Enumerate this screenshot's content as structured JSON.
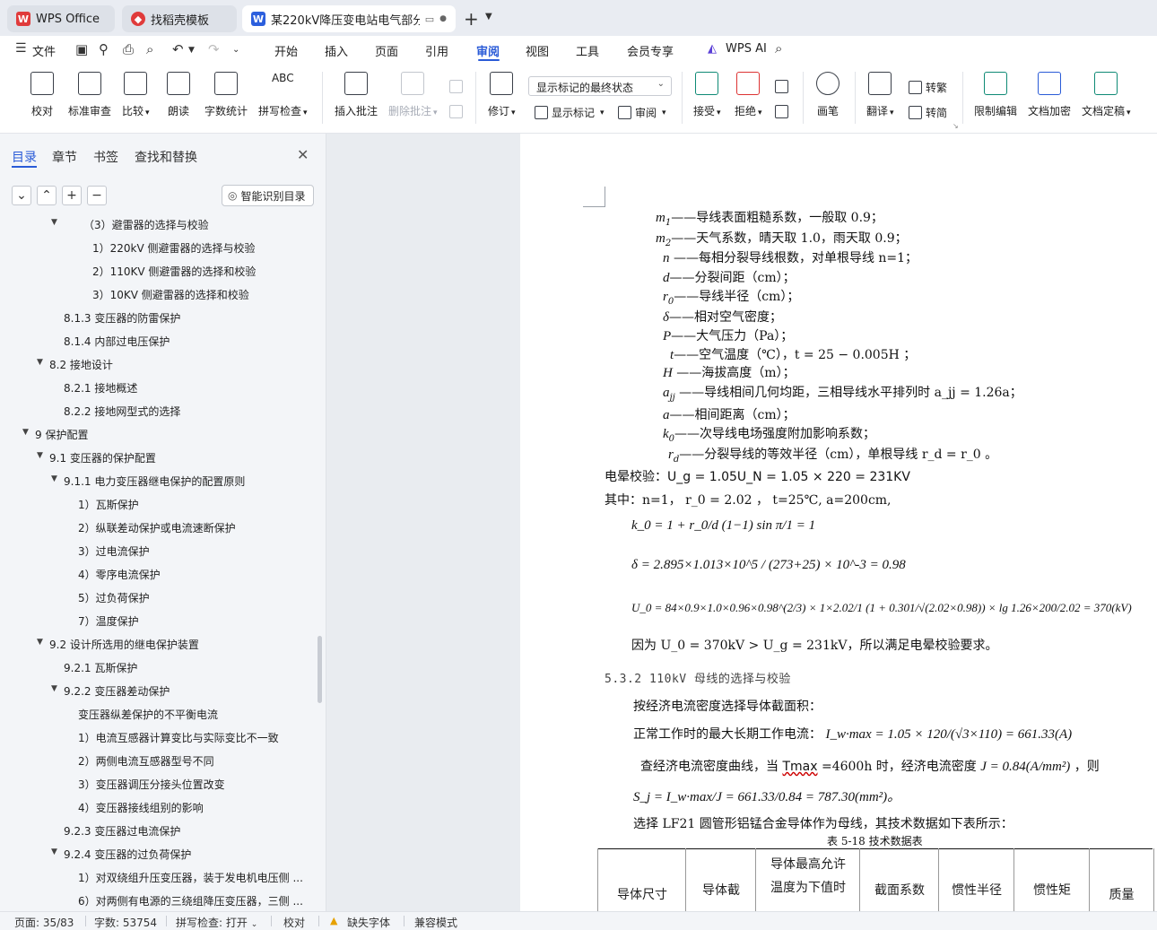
{
  "tabs": [
    {
      "label": "WPS Office",
      "icon": "wps-logo-icon"
    },
    {
      "label": "找稻壳模板",
      "icon": "docer-icon"
    },
    {
      "label": "某220kV降压变电站电气部分",
      "icon": "word-doc-icon",
      "active": true
    }
  ],
  "menu": {
    "file": "文件",
    "items": [
      "开始",
      "插入",
      "页面",
      "引用",
      "审阅",
      "视图",
      "工具",
      "会员专享"
    ],
    "active": "审阅",
    "ai": "WPS AI"
  },
  "ribbon": {
    "proofread": "校对",
    "standard_review": "标准审查",
    "compare": "比较",
    "read_aloud": "朗读",
    "word_count": "字数统计",
    "spellcheck": "拼写检查",
    "spellcheck_icon_text": "ABC",
    "insert_comment": "插入批注",
    "delete_comment": "删除批注",
    "track_changes": "修订",
    "markup_display_value": "显示标记的最终状态",
    "show_markup": "显示标记",
    "review_pane": "审阅",
    "accept": "接受",
    "reject": "拒绝",
    "pen": "画笔",
    "translate": "翻译",
    "to_traditional": "转繁",
    "to_simplified": "转简",
    "restrict_edit": "限制编辑",
    "encrypt": "文档加密",
    "finalize": "文档定稿"
  },
  "nav": {
    "tabs": [
      "目录",
      "章节",
      "书签",
      "查找和替换"
    ],
    "smart_toc": "智能识别目录",
    "toc": [
      {
        "label": "（3）避雷器的选择与校验",
        "level": 2,
        "arrow": "down"
      },
      {
        "label": "1）220kV 侧避雷器的选择与校验",
        "level": 3
      },
      {
        "label": "2）110KV 侧避雷器的选择和校验",
        "level": 3
      },
      {
        "label": "3）10KV 侧避雷器的选择和校验",
        "level": 3
      },
      {
        "label": "8.1.3  变压器的防雷保护",
        "level": 2
      },
      {
        "label": "8.1.4 内部过电压保护",
        "level": 2
      },
      {
        "label": "8.2  接地设计",
        "level": 1,
        "arrow": "down"
      },
      {
        "label": "8.2.1  接地概述",
        "level": 2
      },
      {
        "label": "8.2.2  接地网型式的选择",
        "level": 2
      },
      {
        "label": "9  保护配置",
        "level": 0,
        "arrow": "down"
      },
      {
        "label": "9.1  变压器的保护配置",
        "level": 1,
        "arrow": "down"
      },
      {
        "label": "9.1.1 电力变压器继电保护的配置原则",
        "level": 2,
        "arrow": "down"
      },
      {
        "label": "1）瓦斯保护",
        "level": 3
      },
      {
        "label": "2）纵联差动保护或电流速断保护",
        "level": 3
      },
      {
        "label": "3）过电流保护",
        "level": 3
      },
      {
        "label": "4）零序电流保护",
        "level": 3
      },
      {
        "label": "5）过负荷保护",
        "level": 3
      },
      {
        "label": "7）温度保护",
        "level": 3
      },
      {
        "label": "9.2 设计所选用的继电保护装置",
        "level": 1,
        "arrow": "down"
      },
      {
        "label": "9.2.1 瓦斯保护",
        "level": 2
      },
      {
        "label": "9.2.2 变压器差动保护",
        "level": 2,
        "arrow": "down"
      },
      {
        "label": "变压器纵差保护的不平衡电流",
        "level": 3
      },
      {
        "label": "1）电流互感器计算变比与实际变比不一致",
        "level": 3
      },
      {
        "label": "2）两侧电流互感器型号不同",
        "level": 3
      },
      {
        "label": "3）变压器调压分接头位置改变",
        "level": 3
      },
      {
        "label": "4）变压器接线组别的影响",
        "level": 3
      },
      {
        "label": "9.2.3  变压器过电流保护",
        "level": 2
      },
      {
        "label": "9.2.4 变压器的过负荷保护",
        "level": 2,
        "arrow": "down"
      },
      {
        "label": "1）对双绕组升压变压器，装于发电机电压侧 ...",
        "level": 3
      },
      {
        "label": "6）对两侧有电源的三绕组降压变压器，三侧 ...",
        "level": 3
      }
    ]
  },
  "doc": {
    "defs": [
      {
        "sym": "m",
        "sub": "1",
        "text": "——导线表面粗糙系数，一般取 0.9；"
      },
      {
        "sym": "m",
        "sub": "2",
        "text": "——天气系数，晴天取 1.0，雨天取 0.9；"
      },
      {
        "sym": "n",
        "sub": "",
        "text": " ——每相分裂导线根数，对单根导线 n=1；"
      },
      {
        "sym": "d",
        "sub": "",
        "text": "——分裂间距（cm）；"
      },
      {
        "sym": "r",
        "sub": "0",
        "text": "——导线半径（cm）；"
      },
      {
        "sym": "δ",
        "sub": "",
        "text": "——相对空气密度；"
      },
      {
        "sym": "P",
        "sub": "",
        "text": "——大气压力（Pa）；"
      },
      {
        "sym": "t",
        "sub": "",
        "text": "——空气温度（℃），t = 25 − 0.005H ；"
      },
      {
        "sym": "H",
        "sub": "",
        "text": " ——海拔高度（m）；"
      },
      {
        "sym": "a",
        "sub": "jj",
        "text": " ——导线相间几何均距，三相导线水平排列时 a_jj = 1.26a；"
      },
      {
        "sym": "a",
        "sub": "",
        "text": "——相间距离（cm）；"
      },
      {
        "sym": "k",
        "sub": "0",
        "text": "——次导线电场强度附加影响系数；"
      },
      {
        "sym": "r",
        "sub": "d",
        "text": "——分裂导线的等效半径（cm），单根导线 r_d = r_0 。"
      }
    ],
    "corona_check": "电晕校验：U_g = 1.05U_N = 1.05 × 220 = 231KV",
    "given": "其中：n=1， r_0 = 2.02 ， t=25℃, a=200cm,",
    "k0_formula": "k_0 = 1 + r_0/d (1−1) sin π/1 = 1",
    "delta_formula": "δ = 2.895×1.013×10^5 / (273+25) × 10^-3 = 0.98",
    "u0_formula": "U_0 = 84×0.9×1.0×0.96×0.98^(2/3) × 1×2.02/1 (1 + 0.301/√(2.02×0.98)) × lg 1.26×200/2.02 = 370(kV)",
    "conclusion": "因为 U_0 = 370kV > U_g = 231kV，所以满足电晕校验要求。",
    "section_heading": "5.3.2  110kV 母线的选择与校验",
    "p1": "按经济电流密度选择导体截面积：",
    "p2_prefix": "正常工作时的最大长期工作电流：",
    "p2_formula": "I_w·max = 1.05 × 120/(√3×110) = 661.33(A)",
    "p3_prefix": "查经济电流密度曲线，当",
    "p3_tmax": "Tmax",
    "p3_mid": "=4600h 时，经济电流密度",
    "p3_formula": "J = 0.84(A/mm²)",
    "p3_suffix": "，则",
    "sj_formula": "S_j = I_w·max/J = 661.33/0.84 = 787.30(mm²)。",
    "p4": "选择 LF21 圆管形铝锰合金导体作为母线，其技术数据如下表所示：",
    "table_caption": "表 5-18    技术数据表",
    "table_headers": [
      "导体尺寸",
      "导体截",
      "导体最高允许",
      "温度为下值时",
      "截面系数",
      "惯性半径",
      "惯性矩",
      "质量"
    ]
  },
  "status": {
    "page": "页面: 35/83",
    "words": "字数: 53754",
    "spell": "拼写检查: 打开",
    "proof": "校对",
    "missing_font": "缺失字体",
    "compat": "兼容模式"
  },
  "colors": {
    "accent": "#2a5bd7",
    "wps_red": "#e03b3b",
    "word_blue": "#2c5fdd",
    "warn": "#e6a100"
  }
}
